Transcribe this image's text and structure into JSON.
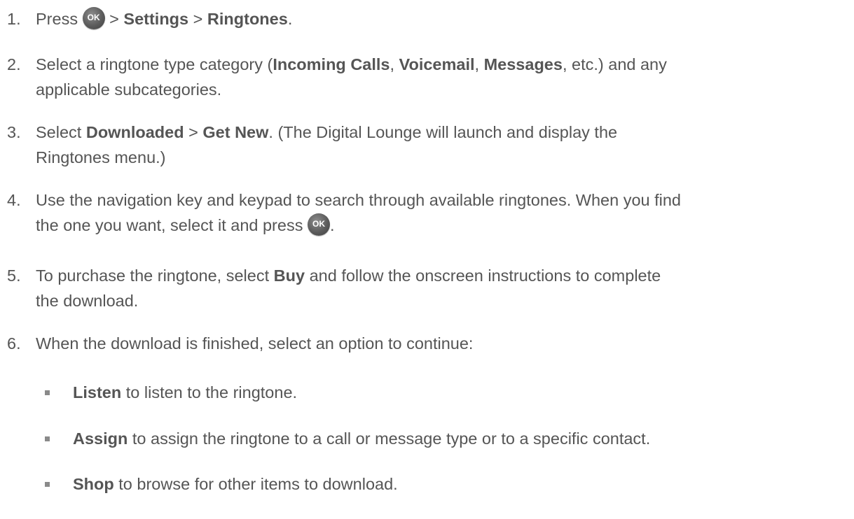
{
  "steps": [
    {
      "num": "1.",
      "parts": [
        "Press",
        "OK",
        ">",
        "Settings",
        ">",
        "Ringtones",
        "."
      ]
    },
    {
      "num": "2.",
      "parts": [
        "Select a ringtone type category (",
        "Incoming Calls",
        ",",
        "Voicemail",
        ",",
        "Messages",
        ", etc.) and any",
        "applicable subcategories."
      ]
    },
    {
      "num": "3.",
      "parts": [
        "Select",
        "Downloaded",
        ">",
        "Get New",
        ". (The Digital Lounge will launch and display the",
        "Ringtones menu.)"
      ]
    },
    {
      "num": "4.",
      "parts": [
        "Use the navigation key and keypad to search through available ringtones. When you find",
        "the one you want, select it and press",
        "OK",
        "."
      ]
    },
    {
      "num": "5.",
      "parts": [
        "To purchase the ringtone, select",
        "Buy",
        "and follow the onscreen instructions to complete",
        "the download."
      ]
    },
    {
      "num": "6.",
      "parts": [
        "When the download is finished, select an option to continue:"
      ]
    }
  ],
  "options": [
    {
      "label": "Listen",
      "text": "to listen to the ringtone."
    },
    {
      "label": "Assign",
      "text": "to assign the ringtone to a call or message type or to a specific contact."
    },
    {
      "label": "Shop",
      "text": "to browse for other items to download."
    }
  ],
  "icons": {
    "ok_key": "ok-button-icon"
  }
}
